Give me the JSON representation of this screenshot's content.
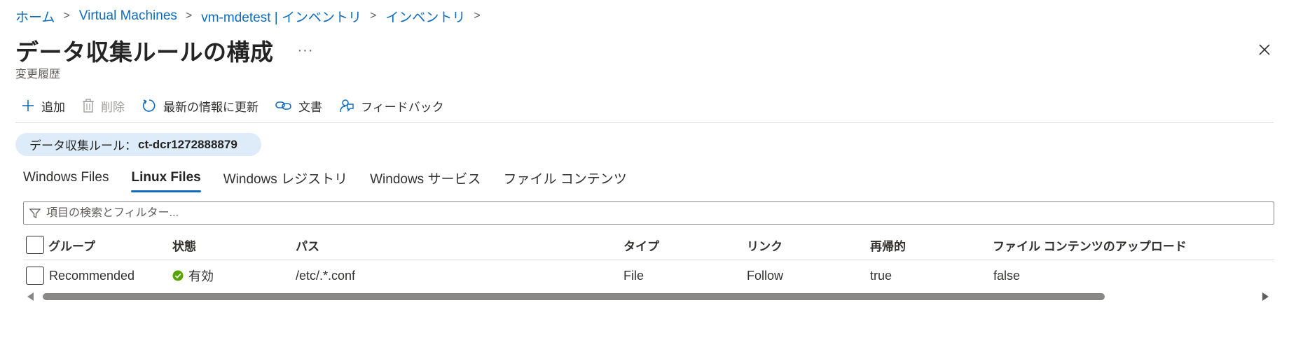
{
  "breadcrumb": {
    "items": [
      "ホーム",
      "Virtual Machines",
      "vm-mdetest | インベントリ",
      "インベントリ"
    ],
    "separator": ">"
  },
  "page": {
    "title": "データ収集ルールの構成",
    "subtitle": "変更履歴",
    "more_label": "···"
  },
  "toolbar": {
    "add_label": "追加",
    "delete_label": "削除",
    "refresh_label": "最新の情報に更新",
    "docs_label": "文書",
    "feedback_label": "フィードバック"
  },
  "dcr": {
    "label": "データ収集ルール：",
    "value": "ct-dcr1272888879"
  },
  "tabs": [
    {
      "label": "Windows Files",
      "active": false
    },
    {
      "label": "Linux Files",
      "active": true
    },
    {
      "label": "Windows レジストリ",
      "active": false
    },
    {
      "label": "Windows サービス",
      "active": false
    },
    {
      "label": "ファイル コンテンツ",
      "active": false
    }
  ],
  "filter": {
    "placeholder": "項目の検索とフィルター..."
  },
  "table": {
    "columns": [
      "グループ",
      "状態",
      "パス",
      "タイプ",
      "リンク",
      "再帰的",
      "ファイル コンテンツのアップロード"
    ],
    "rows": [
      {
        "group": "Recommended",
        "status": "有効",
        "path": "/etc/.*.conf",
        "type": "File",
        "link": "Follow",
        "recursive": "true",
        "upload": "false"
      }
    ]
  },
  "colors": {
    "accent": "#0f6cbd",
    "success": "#57a300",
    "pill_bg": "#deecf9"
  }
}
